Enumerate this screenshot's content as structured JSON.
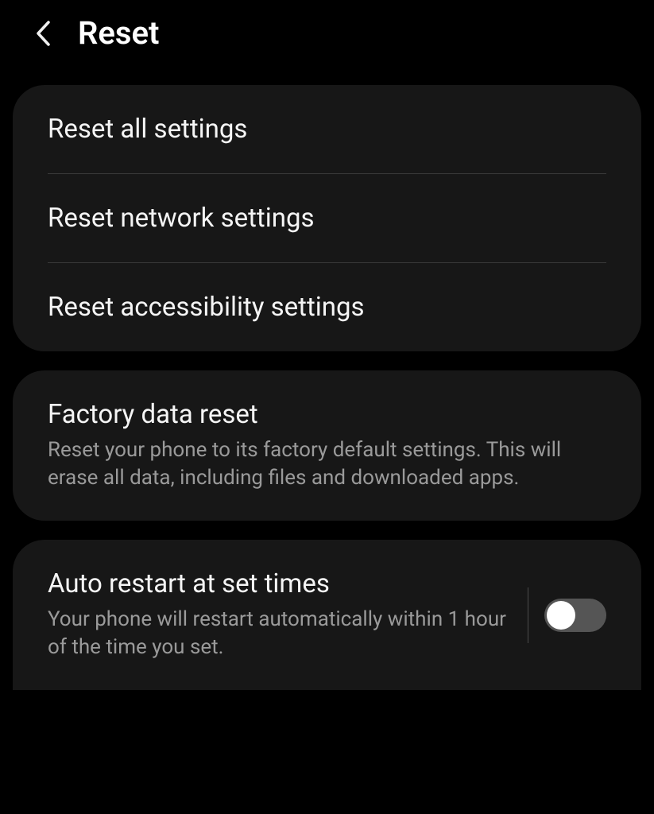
{
  "header": {
    "title": "Reset"
  },
  "card1": {
    "items": [
      {
        "label": "Reset all settings"
      },
      {
        "label": "Reset network settings"
      },
      {
        "label": "Reset accessibility settings"
      }
    ]
  },
  "card2": {
    "title": "Factory data reset",
    "description": "Reset your phone to its factory default settings. This will erase all data, including files and downloaded apps."
  },
  "card3": {
    "title": "Auto restart at set times",
    "description": "Your phone will restart automatically within 1 hour of the time you set.",
    "toggle": false
  }
}
